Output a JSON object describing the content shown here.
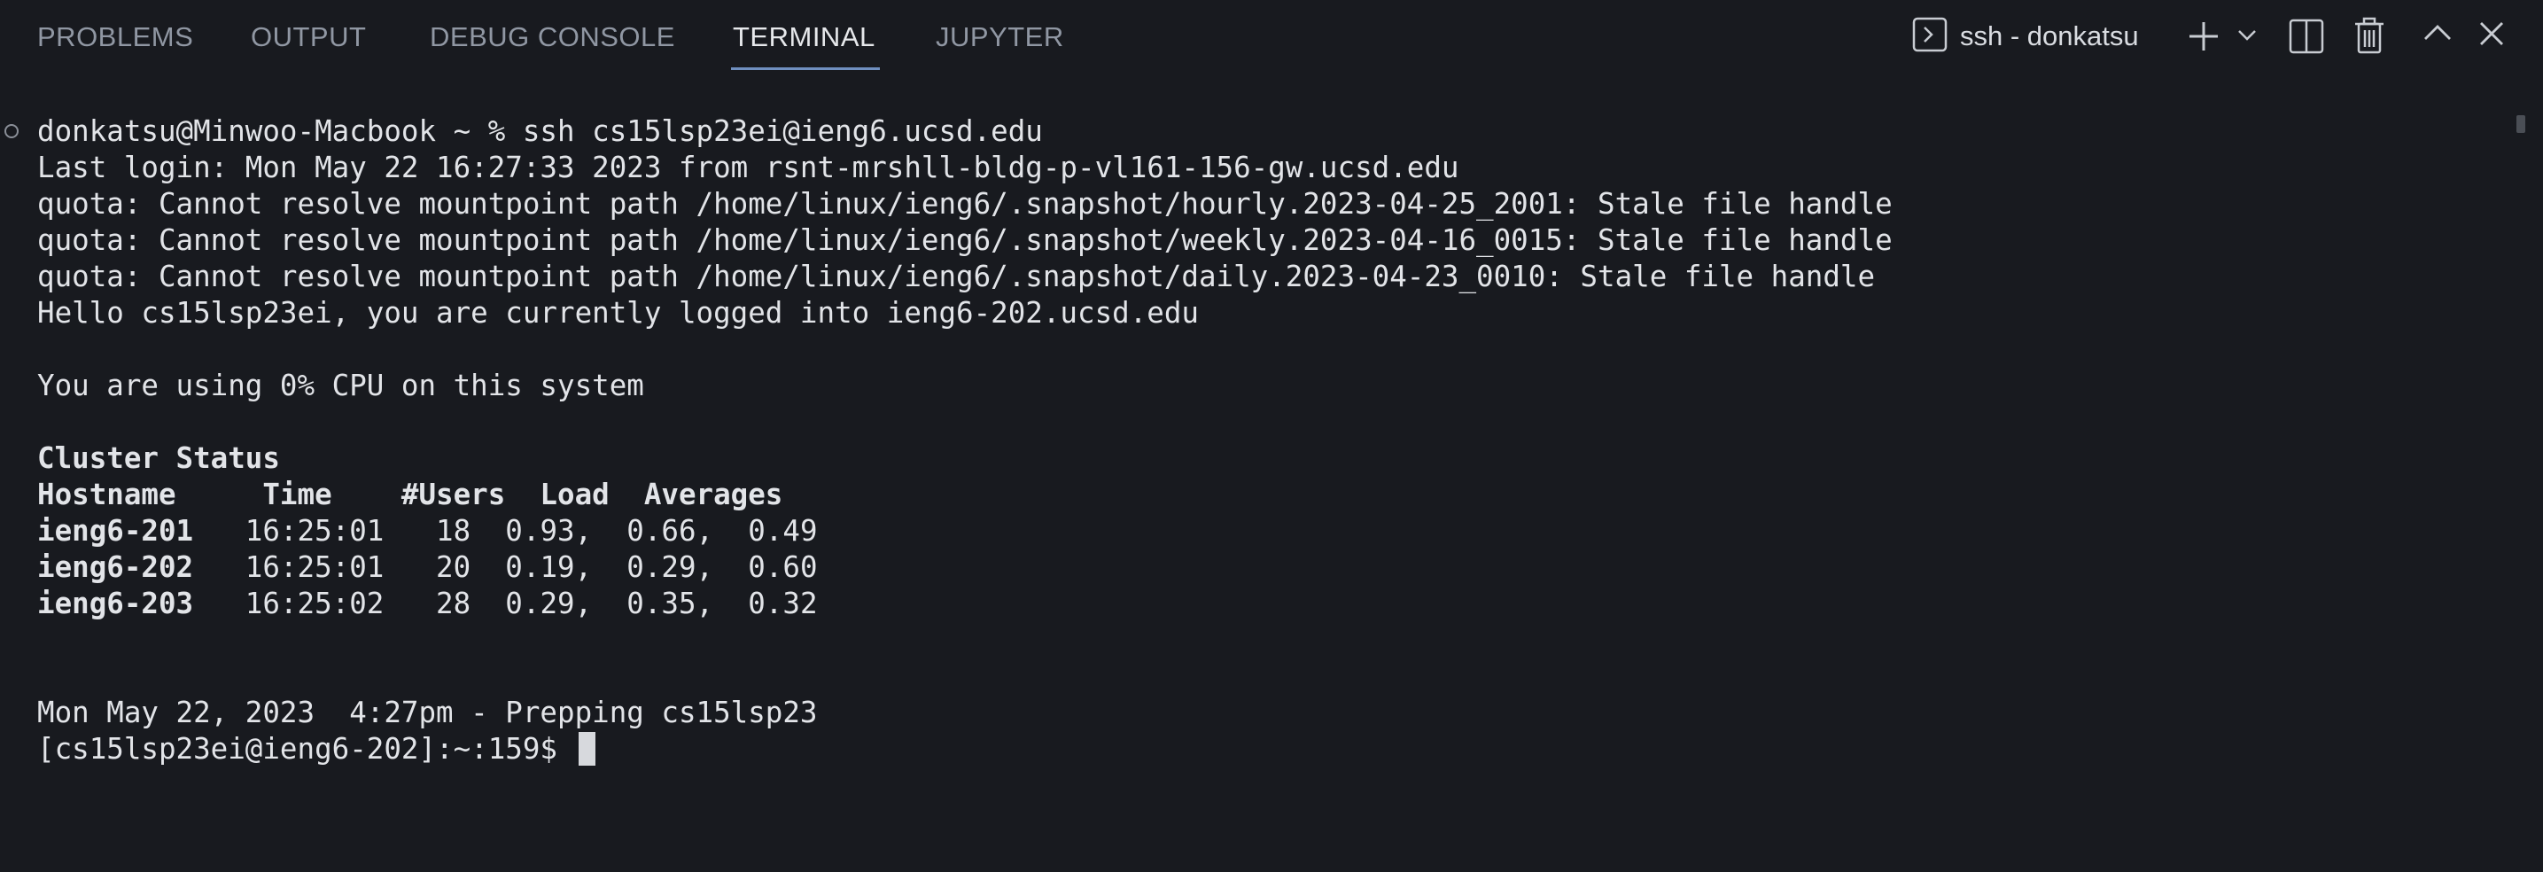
{
  "panel": {
    "tabs": [
      {
        "label": "PROBLEMS"
      },
      {
        "label": "OUTPUT"
      },
      {
        "label": "DEBUG CONSOLE"
      },
      {
        "label": "TERMINAL"
      },
      {
        "label": "JUPYTER"
      }
    ],
    "active_tab": "TERMINAL",
    "terminal_name": "ssh - donkatsu",
    "icons": [
      "terminal-icon",
      "plus-icon",
      "chevron-down-icon",
      "split-icon",
      "trash-icon",
      "maximize-icon",
      "close-icon"
    ]
  },
  "terminal": {
    "prompt_line": "donkatsu@Minwoo-Macbook ~ % ssh cs15lsp23ei@ieng6.ucsd.edu",
    "output": [
      "Last login: Mon May 22 16:27:33 2023 from rsnt-mrshll-bldg-p-vl161-156-gw.ucsd.edu",
      "quota: Cannot resolve mountpoint path /home/linux/ieng6/.snapshot/hourly.2023-04-25_2001: Stale file handle",
      "quota: Cannot resolve mountpoint path /home/linux/ieng6/.snapshot/weekly.2023-04-16_0015: Stale file handle",
      "quota: Cannot resolve mountpoint path /home/linux/ieng6/.snapshot/daily.2023-04-23_0010: Stale file handle",
      "Hello cs15lsp23ei, you are currently logged into ieng6-202.ucsd.edu",
      "You are using 0% CPU on this system"
    ],
    "cluster": {
      "title": "Cluster Status",
      "header": "Hostname     Time    #Users  Load  Averages",
      "rows": [
        {
          "host": "ieng6-201",
          "rest": "   16:25:01   18  0.93,  0.66,  0.49"
        },
        {
          "host": "ieng6-202",
          "rest": "   16:25:01   20  0.19,  0.29,  0.60"
        },
        {
          "host": "ieng6-203",
          "rest": "   16:25:02   28  0.29,  0.35,  0.32"
        }
      ]
    },
    "banner": "Mon May 22, 2023  4:27pm - Prepping cs15lsp23",
    "current_prompt": "[cs15lsp23ei@ieng6-202]:~:159$ "
  },
  "colors": {
    "background": "#181a1f",
    "text": "#e2e4e8",
    "tab_inactive": "#9097a3",
    "tab_active": "#e6e8eb",
    "tab_underline": "#6f8fbf"
  }
}
